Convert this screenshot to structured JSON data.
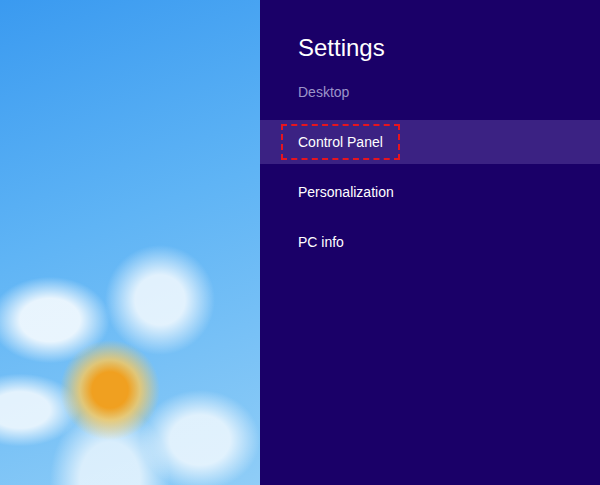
{
  "panel": {
    "title": "Settings"
  },
  "items": [
    {
      "label": "Desktop",
      "selected": false,
      "disabled": true,
      "annotated": false
    },
    {
      "label": "Control Panel",
      "selected": true,
      "disabled": false,
      "annotated": true
    },
    {
      "label": "Personalization",
      "selected": false,
      "disabled": false,
      "annotated": false
    },
    {
      "label": "PC info",
      "selected": false,
      "disabled": false,
      "annotated": false
    }
  ]
}
